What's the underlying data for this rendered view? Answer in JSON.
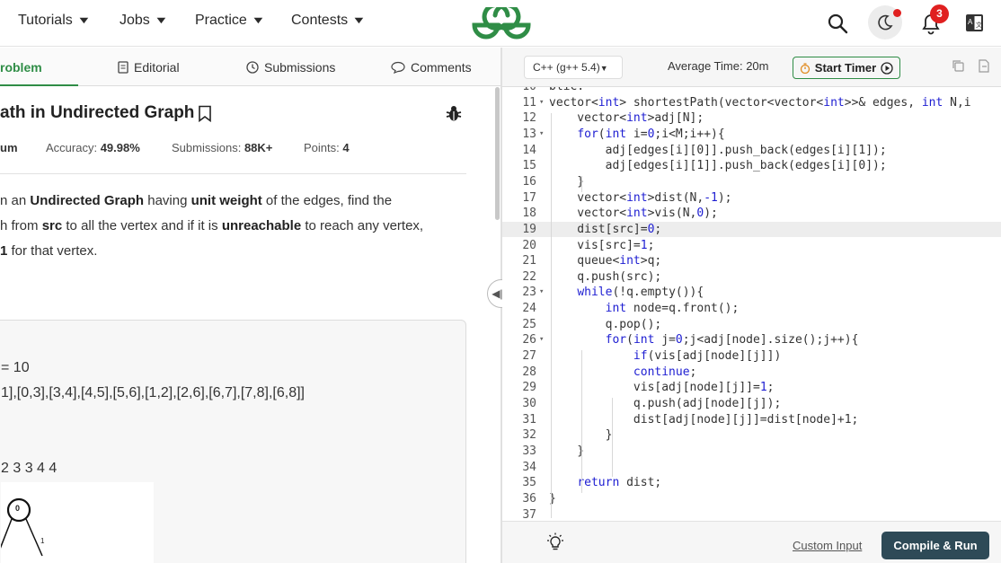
{
  "nav": {
    "menus": [
      {
        "label": "Tutorials"
      },
      {
        "label": "Jobs"
      },
      {
        "label": "Practice"
      },
      {
        "label": "Contests"
      }
    ],
    "notification_count": "3",
    "brand_color": "#2f8d46"
  },
  "left_tabs": {
    "problem": "roblem",
    "editorial": "Editorial",
    "submissions": "Submissions",
    "comments": "Comments"
  },
  "problem": {
    "title": "ath in Undirected Graph",
    "difficulty": "um",
    "accuracy_label": "Accuracy:",
    "accuracy_value": "49.98%",
    "submissions_label": "Submissions:",
    "submissions_value": "88K+",
    "points_label": "Points:",
    "points_value": "4",
    "para_line1_a": "n an ",
    "para_line1_b": "Undirected Graph",
    "para_line1_c": " having ",
    "para_line1_d": "unit weight",
    "para_line1_e": " of the edges, find the",
    "para_line2_a": "h from ",
    "para_line2_b": "src",
    "para_line2_c": " to all the vertex and if it is ",
    "para_line2_d": "unreachable",
    "para_line2_e": " to reach any vertex,",
    "para_line3_a": "1",
    "para_line3_b": " for that vertex."
  },
  "example": {
    "line1": "= 10",
    "line2": "1],[0,3],[3,4],[4,5],[5,6],[1,2],[2,6],[6,7],[7,8],[6,8]]",
    "line3": "2 3 3 4 4",
    "graph_node": "0",
    "edge_label_left": "1",
    "edge_label_right": "1"
  },
  "editor": {
    "language": "C++ (g++ 5.4)",
    "average_time": "Average Time: 20m",
    "timer_label": "Start Timer",
    "lines": [
      {
        "n": "10",
        "code": "blic:"
      },
      {
        "n": "11",
        "code": "vector<int> shortestPath(vector<vector<int>>& edges, int N,i"
      },
      {
        "n": "12",
        "code": "    vector<int>adj[N];"
      },
      {
        "n": "13",
        "code": "    for(int i=0;i<M;i++){"
      },
      {
        "n": "14",
        "code": "        adj[edges[i][0]].push_back(edges[i][1]);"
      },
      {
        "n": "15",
        "code": "        adj[edges[i][1]].push_back(edges[i][0]);"
      },
      {
        "n": "16",
        "code": "    }"
      },
      {
        "n": "17",
        "code": "    vector<int>dist(N,-1);"
      },
      {
        "n": "18",
        "code": "    vector<int>vis(N,0);"
      },
      {
        "n": "19",
        "code": "    dist[src]=0;"
      },
      {
        "n": "20",
        "code": "    vis[src]=1;"
      },
      {
        "n": "21",
        "code": "    queue<int>q;"
      },
      {
        "n": "22",
        "code": "    q.push(src);"
      },
      {
        "n": "23",
        "code": "    while(!q.empty()){"
      },
      {
        "n": "24",
        "code": "        int node=q.front();"
      },
      {
        "n": "25",
        "code": "        q.pop();"
      },
      {
        "n": "26",
        "code": "        for(int j=0;j<adj[node].size();j++){"
      },
      {
        "n": "27",
        "code": "            if(vis[adj[node][j]])"
      },
      {
        "n": "28",
        "code": "            continue;"
      },
      {
        "n": "29",
        "code": "            vis[adj[node][j]]=1;"
      },
      {
        "n": "30",
        "code": "            q.push(adj[node][j]);"
      },
      {
        "n": "31",
        "code": "            dist[adj[node][j]]=dist[node]+1;"
      },
      {
        "n": "32",
        "code": "        }"
      },
      {
        "n": "33",
        "code": "    }"
      },
      {
        "n": "34",
        "code": ""
      },
      {
        "n": "35",
        "code": "    return dist;"
      },
      {
        "n": "36",
        "code": "}"
      },
      {
        "n": "37",
        "code": ""
      }
    ]
  },
  "footer": {
    "custom_input": "Custom Input",
    "compile_run": "Compile & Run"
  }
}
